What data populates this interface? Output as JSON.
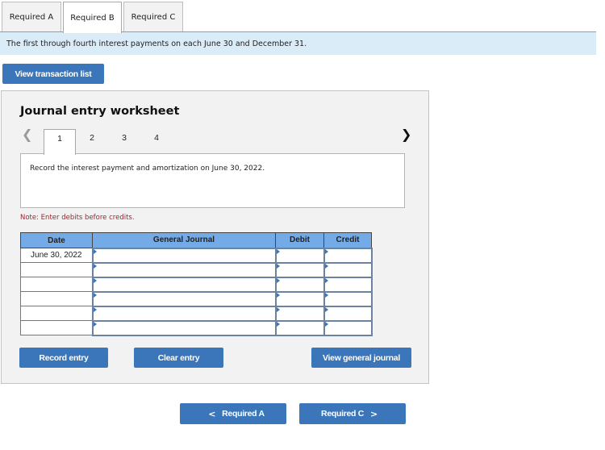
{
  "tabs": [
    {
      "label": "Required A",
      "active": false
    },
    {
      "label": "Required B",
      "active": true
    },
    {
      "label": "Required C",
      "active": false
    }
  ],
  "banner": {
    "text": "The first through fourth interest payments on each June 30 and December 31."
  },
  "buttons": {
    "view_transaction_list": "View transaction list",
    "record_entry": "Record entry",
    "clear_entry": "Clear entry",
    "view_general_journal": "View general journal"
  },
  "worksheet": {
    "title": "Journal entry worksheet",
    "prev_icon": "‹",
    "next_icon": "›",
    "steps": [
      "1",
      "2",
      "3",
      "4"
    ],
    "active_step": "1",
    "instruction": "Record the interest payment and amortization on June 30, 2022.",
    "note": "Note: Enter debits before credits."
  },
  "journal_table": {
    "columns": [
      "Date",
      "General Journal",
      "Debit",
      "Credit"
    ],
    "rows": [
      {
        "date": "June 30, 2022",
        "account": "",
        "debit": "",
        "credit": ""
      },
      {
        "date": "",
        "account": "",
        "debit": "",
        "credit": ""
      },
      {
        "date": "",
        "account": "",
        "debit": "",
        "credit": ""
      },
      {
        "date": "",
        "account": "",
        "debit": "",
        "credit": ""
      },
      {
        "date": "",
        "account": "",
        "debit": "",
        "credit": ""
      },
      {
        "date": "",
        "account": "",
        "debit": "",
        "credit": ""
      }
    ]
  },
  "footer_nav": {
    "prev_label": "Required A",
    "prev_icon": "<",
    "next_label": "Required C",
    "next_icon": ">"
  },
  "colors": {
    "button_blue": "#3a76b9",
    "header_blue": "#74aae6",
    "banner_bg": "#dbecf9",
    "note_red": "#a0252c"
  }
}
